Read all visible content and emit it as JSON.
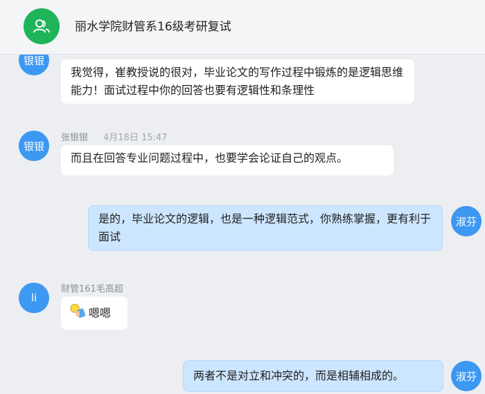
{
  "header": {
    "title": "丽水学院财管系16级考研复试",
    "icon": "group-icon"
  },
  "messages": [
    {
      "avatar": "银银",
      "text": "我觉得，崔教授说的很对，毕业论文的写作过程中锻炼的是逻辑思维能力！面试过程中你的回答也要有逻辑性和条理性"
    },
    {
      "avatar": "银银",
      "sender": "张银银",
      "time": "4月18日 15:47",
      "text": "而且在回答专业问题过程中，也要学会论证自己的观点。"
    },
    {
      "avatar": "淑芬",
      "text": "是的，毕业论文的逻辑，也是一种逻辑范式，你熟练掌握，更有利于面试"
    },
    {
      "avatar": "li",
      "sender": "财管161毛高超",
      "emoji": "thumbs-up-emoji",
      "text": "嗯嗯"
    },
    {
      "avatar": "淑芬",
      "text": "两者不是对立和冲突的，而是相辅相成的。"
    }
  ],
  "colors": {
    "avatar_blue": "#3d98f2",
    "group_green": "#1fb35a",
    "bubble_self": "#cde6ff"
  }
}
